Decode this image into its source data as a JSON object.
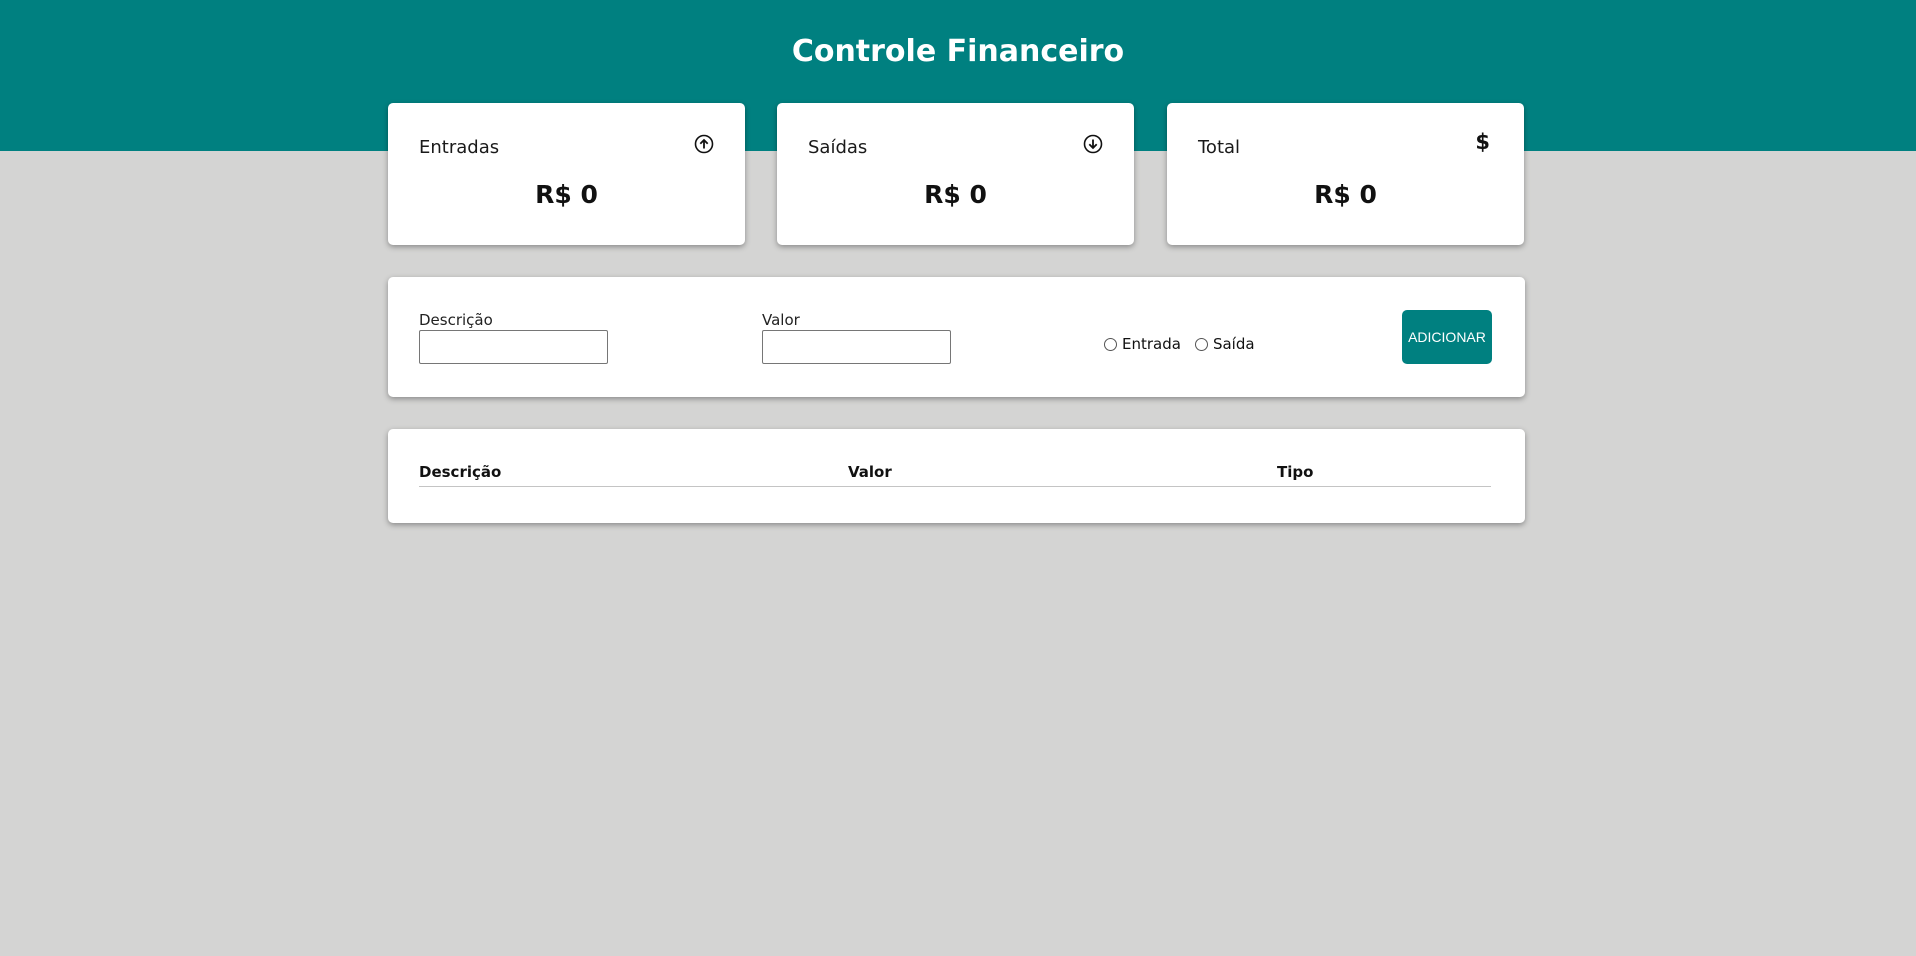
{
  "header": {
    "title": "Controle Financeiro",
    "color": "#008080"
  },
  "summary": {
    "entradas": {
      "label": "Entradas",
      "value": "R$ 0",
      "icon": "arrow-up-circle-icon"
    },
    "saidas": {
      "label": "Saídas",
      "value": "R$ 0",
      "icon": "arrow-down-circle-icon"
    },
    "total": {
      "label": "Total",
      "value": "R$ 0",
      "icon": "$"
    }
  },
  "form": {
    "description_label": "Descrição",
    "description_value": "",
    "amount_label": "Valor",
    "amount_value": "",
    "type_options": [
      "Entrada",
      "Saída"
    ],
    "add_button_label": "ADICIONAR"
  },
  "table": {
    "columns": [
      "Descrição",
      "Valor",
      "Tipo"
    ],
    "rows": []
  }
}
